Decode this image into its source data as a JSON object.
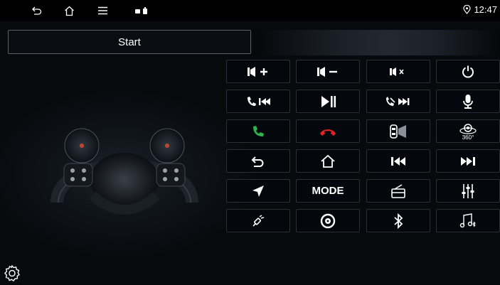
{
  "status_bar": {
    "time": "12:47",
    "icons": [
      "back-icon",
      "home-icon",
      "menu-icon",
      "notification-icons",
      "location-icon"
    ]
  },
  "start_button": {
    "label": "Start"
  },
  "keys": [
    {
      "name": "volume-up",
      "icon": "volume-up-icon"
    },
    {
      "name": "volume-down",
      "icon": "volume-down-icon"
    },
    {
      "name": "mute",
      "icon": "mute-icon"
    },
    {
      "name": "power",
      "icon": "power-icon"
    },
    {
      "name": "call-previous",
      "icon": "call-previous-icon"
    },
    {
      "name": "play-pause",
      "icon": "play-pause-icon"
    },
    {
      "name": "hangup-next",
      "icon": "hangup-next-icon"
    },
    {
      "name": "voice",
      "icon": "microphone-icon"
    },
    {
      "name": "answer-call",
      "icon": "phone-answer-icon",
      "color": "#2fb24a"
    },
    {
      "name": "end-call",
      "icon": "phone-hangup-icon",
      "color": "#e02424"
    },
    {
      "name": "reverse-camera",
      "icon": "car-camera-icon"
    },
    {
      "name": "360-camera",
      "icon": "camera-360-icon",
      "text": "360°"
    },
    {
      "name": "back",
      "icon": "back-icon"
    },
    {
      "name": "home",
      "icon": "home-icon"
    },
    {
      "name": "previous",
      "icon": "previous-track-icon"
    },
    {
      "name": "next",
      "icon": "next-track-icon"
    },
    {
      "name": "navigation",
      "icon": "navigation-icon"
    },
    {
      "name": "mode",
      "icon": "mode-text",
      "text": "MODE"
    },
    {
      "name": "radio",
      "icon": "radio-icon"
    },
    {
      "name": "equalizer",
      "icon": "equalizer-icon"
    },
    {
      "name": "custom-key",
      "icon": "custom-key-icon"
    },
    {
      "name": "disc",
      "icon": "disc-icon"
    },
    {
      "name": "bluetooth",
      "icon": "bluetooth-icon"
    },
    {
      "name": "bt-music",
      "icon": "bluetooth-music-icon"
    }
  ],
  "settings": {
    "icon": "gear-icon"
  }
}
